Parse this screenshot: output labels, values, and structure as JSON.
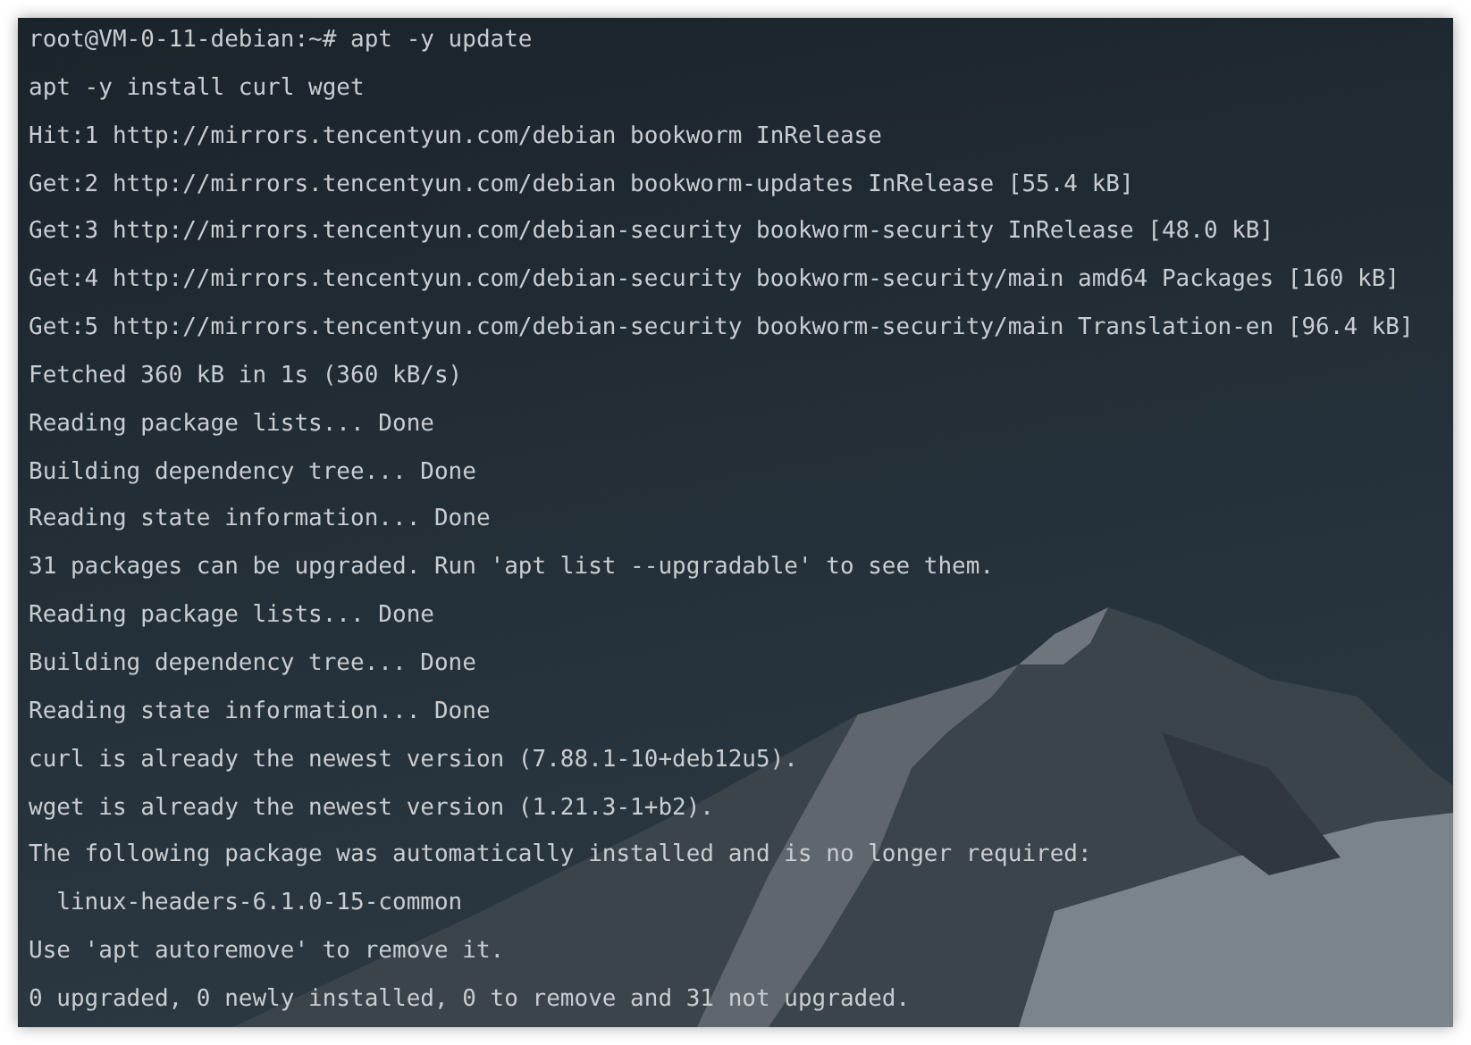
{
  "terminal": {
    "lines": [
      "root@VM-0-11-debian:~# apt -y update",
      "apt -y install curl wget",
      "Hit:1 http://mirrors.tencentyun.com/debian bookworm InRelease",
      "Get:2 http://mirrors.tencentyun.com/debian bookworm-updates InRelease [55.4 kB]",
      "Get:3 http://mirrors.tencentyun.com/debian-security bookworm-security InRelease [48.0 kB]",
      "Get:4 http://mirrors.tencentyun.com/debian-security bookworm-security/main amd64 Packages [160 kB]",
      "Get:5 http://mirrors.tencentyun.com/debian-security bookworm-security/main Translation-en [96.4 kB]",
      "Fetched 360 kB in 1s (360 kB/s)",
      "Reading package lists... Done",
      "Building dependency tree... Done",
      "Reading state information... Done",
      "31 packages can be upgraded. Run 'apt list --upgradable' to see them.",
      "Reading package lists... Done",
      "Building dependency tree... Done",
      "Reading state information... Done",
      "curl is already the newest version (7.88.1-10+deb12u5).",
      "wget is already the newest version (1.21.3-1+b2).",
      "The following package was automatically installed and is no longer required:",
      "  linux-headers-6.1.0-15-common",
      "Use 'apt autoremove' to remove it.",
      "0 upgraded, 0 newly installed, 0 to remove and 31 not upgraded."
    ]
  }
}
